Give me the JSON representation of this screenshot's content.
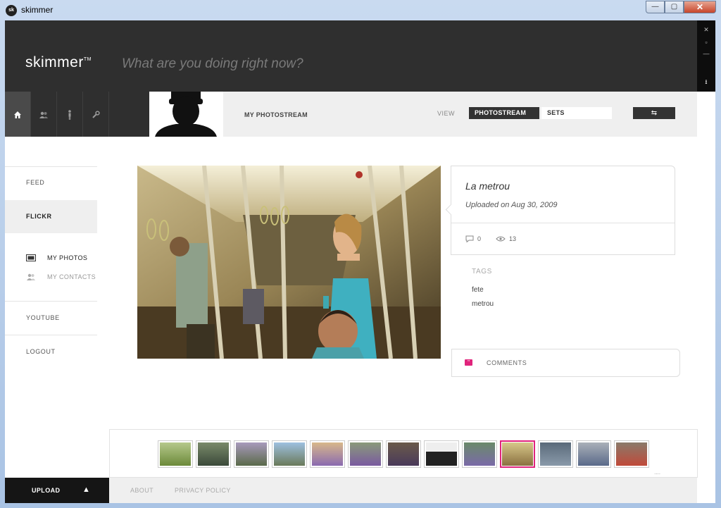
{
  "window": {
    "title": "skimmer",
    "badge": "sk",
    "controls": {
      "minimize": "—",
      "maximize": "▢",
      "close": "✕"
    }
  },
  "header": {
    "logo": "skimmer",
    "status_placeholder": "What are you doing right now?",
    "side_controls": [
      "✕",
      "▫",
      "—",
      "⭳"
    ]
  },
  "nav": {
    "icons": [
      "home-icon",
      "contacts-icon",
      "person-icon",
      "wrench-icon"
    ]
  },
  "toolbar": {
    "title": "MY PHOTOSTREAM",
    "view_label": "VIEW",
    "tabs": [
      {
        "label": "PHOTOSTREAM",
        "active": true
      },
      {
        "label": "SETS",
        "active": false
      }
    ],
    "swap_glyph": "⇆"
  },
  "sidebar": {
    "items": [
      {
        "label": "FEED"
      },
      {
        "label": "FLICKR"
      },
      {
        "label": "YOUTUBE"
      },
      {
        "label": "LOGOUT"
      }
    ],
    "sub_items": [
      {
        "label": "MY PHOTOS"
      },
      {
        "label": "MY CONTACTS"
      }
    ]
  },
  "photo": {
    "title": "La metrou",
    "uploaded": "Uploaded on Aug 30, 2009",
    "comments_count": "0",
    "views_count": "13"
  },
  "tags": {
    "label": "TAGS",
    "items": [
      "fete",
      "metrou"
    ]
  },
  "comments": {
    "label": "COMMENTS"
  },
  "filmstrip": {
    "count": 13,
    "selected_index": 9,
    "more": "...."
  },
  "footer": {
    "upload_label": "UPLOAD",
    "links": [
      "ABOUT",
      "PRIVACY POLICY"
    ]
  },
  "colors": {
    "accent": "#e0247c",
    "dark": "#2f2f2f",
    "light_panel": "#efefef"
  }
}
